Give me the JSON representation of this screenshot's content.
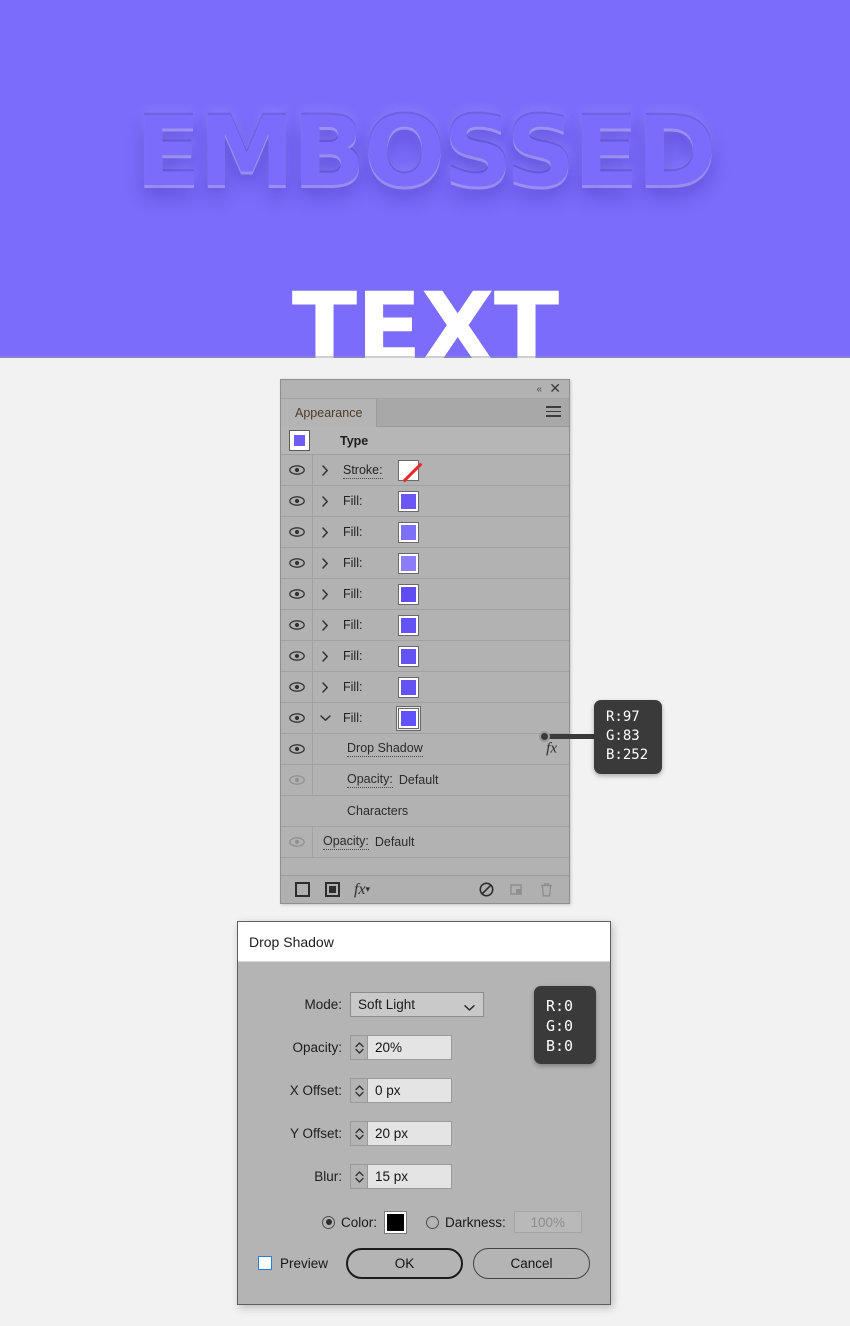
{
  "artwork": {
    "word_top": "EMBOSSED",
    "word_bottom": "TEXT",
    "background_color": "#7b6cfb",
    "text_color": "#ffffff"
  },
  "appearance_panel": {
    "tab_label": "Appearance",
    "collapse_icon": "«",
    "close_icon": "✕",
    "menu_icon": "hamburger-menu-icon",
    "object_type_label": "Type",
    "rows": [
      {
        "label": "Stroke:",
        "kind": "stroke",
        "expanded": false,
        "visible": true,
        "swatch": "none"
      },
      {
        "label": "Fill:",
        "kind": "fill",
        "expanded": false,
        "visible": true,
        "swatch": "#6b58f4"
      },
      {
        "label": "Fill:",
        "kind": "fill",
        "expanded": false,
        "visible": true,
        "swatch": "#7e6ff8"
      },
      {
        "label": "Fill:",
        "kind": "fill",
        "expanded": false,
        "visible": true,
        "swatch": "#8b7cf9"
      },
      {
        "label": "Fill:",
        "kind": "fill",
        "expanded": false,
        "visible": true,
        "swatch": "#5f4cf3"
      },
      {
        "label": "Fill:",
        "kind": "fill",
        "expanded": false,
        "visible": true,
        "swatch": "#6453f4"
      },
      {
        "label": "Fill:",
        "kind": "fill",
        "expanded": false,
        "visible": true,
        "swatch": "#6453f4"
      },
      {
        "label": "Fill:",
        "kind": "fill",
        "expanded": false,
        "visible": true,
        "swatch": "#6453f4"
      },
      {
        "label": "Fill:",
        "kind": "fill",
        "expanded": true,
        "visible": true,
        "swatch": "#6153fc",
        "selected": true
      }
    ],
    "effect_row": {
      "label": "Drop Shadow",
      "fx": "fx",
      "visible": true
    },
    "opacity_row_1": {
      "label": "Opacity:",
      "value": "Default",
      "visible": false
    },
    "characters_row": {
      "label": "Characters"
    },
    "opacity_row_2": {
      "label": "Opacity:",
      "value": "Default",
      "visible": false
    },
    "footer_icons": [
      "add-new-stroke-icon",
      "add-new-fill-icon",
      "add-new-effect-icon",
      "clear-appearance-icon",
      "duplicate-item-icon",
      "delete-item-icon"
    ]
  },
  "tooltips": {
    "fill_color": {
      "r": "R:97",
      "g": "G:83",
      "b": "B:252"
    },
    "shadow_color": {
      "r": "R:0",
      "g": "G:0",
      "b": "B:0"
    }
  },
  "drop_shadow_dialog": {
    "title": "Drop Shadow",
    "fields": {
      "mode_label": "Mode:",
      "mode_value": "Soft Light",
      "opacity_label": "Opacity:",
      "opacity_value": "20%",
      "x_offset_label": "X Offset:",
      "x_offset_value": "0 px",
      "y_offset_label": "Y Offset:",
      "y_offset_value": "20 px",
      "blur_label": "Blur:",
      "blur_value": "15 px"
    },
    "color_option": {
      "color_label": "Color:",
      "color_value": "#000000",
      "darkness_label": "Darkness:",
      "darkness_value": "100%"
    },
    "preview_label": "Preview",
    "ok_label": "OK",
    "cancel_label": "Cancel"
  }
}
